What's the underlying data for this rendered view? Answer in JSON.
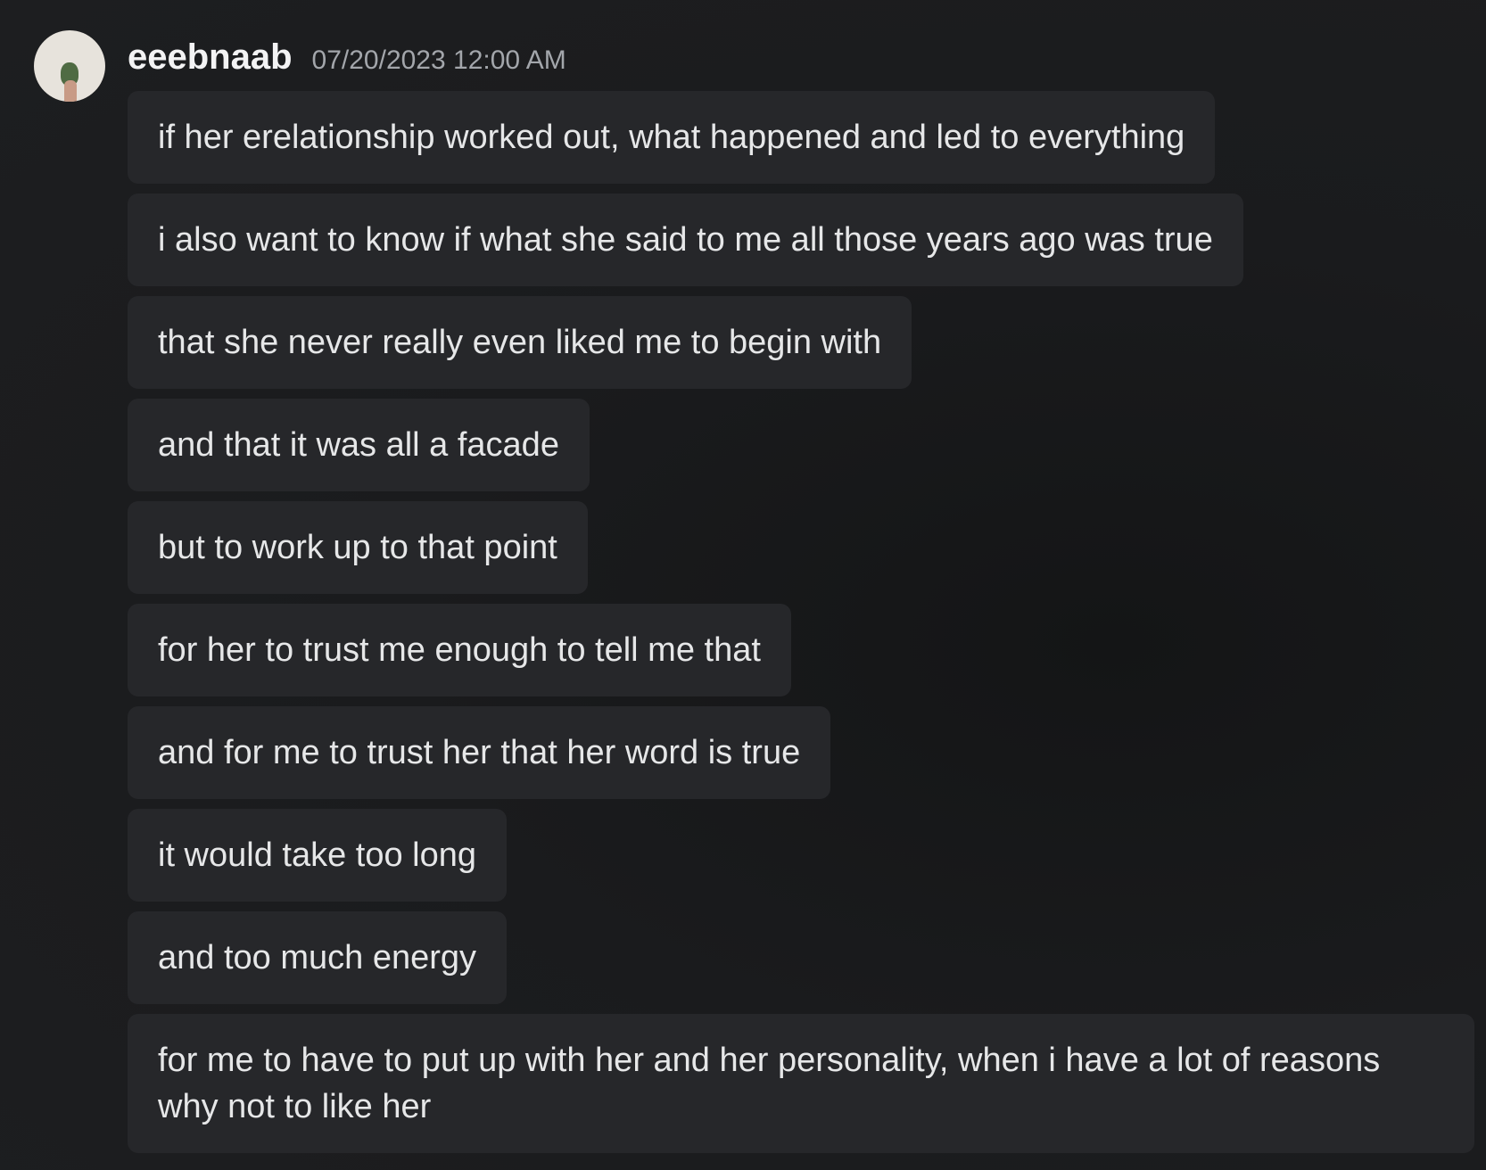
{
  "message_group": {
    "username": "eeebnaab",
    "timestamp": "07/20/2023 12:00 AM",
    "avatar_icon": "frog-on-finger-avatar",
    "messages": [
      "if her erelationship worked out, what happened and led to everything",
      "i also want to know if what she said to me all those years ago was true",
      "that she never really even liked me to begin with",
      "and that it was all a facade",
      "but to work up to that point",
      "for her to trust me enough to tell me that",
      "and for me to trust her that her word is true",
      "it would take too long",
      "and too much energy",
      "for me to have to put up with her and her personality, when i have a lot of reasons why not to like her"
    ]
  },
  "colors": {
    "background": "#1b1c1e",
    "bubble": "#26272a",
    "text": "#e6e7e8",
    "timestamp": "#a3a6ab"
  }
}
